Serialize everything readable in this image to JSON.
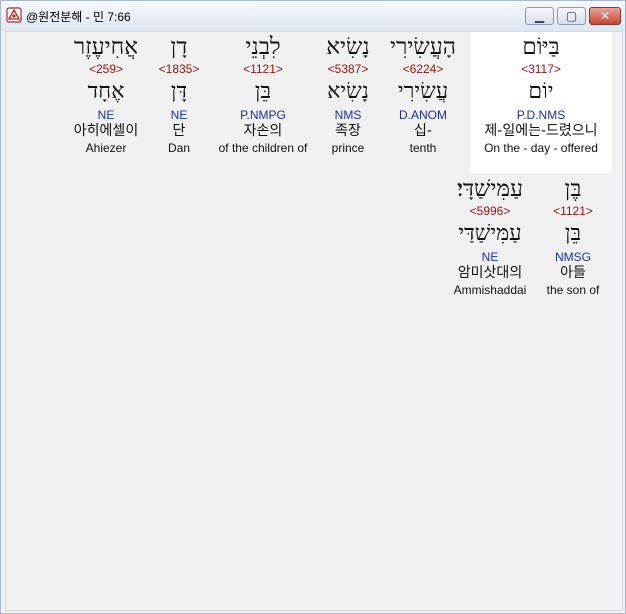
{
  "window": {
    "title": "@원전분해 - 민 7:66",
    "icons": {
      "app": "app-icon",
      "minimize": "minimize-icon",
      "maximize": "maximize-icon",
      "close": "close-icon"
    }
  },
  "colors": {
    "strong": "#9a1010",
    "morph": "#1a2fb0",
    "text": "#111111",
    "highlight": "#ffffff"
  },
  "words": [
    {
      "hebrew": "בַּיּוֹם",
      "strong": "<3117>",
      "lexeme": "יוֹם",
      "morph": "P.D.NMS",
      "korean": "제-일에는-드렸으니",
      "english": "On the - day - offered"
    },
    {
      "hebrew": "הָעֲשִׂירִי",
      "strong": "<6224>",
      "lexeme": "עֲשִׂירִי",
      "morph": "D.ANOM",
      "korean": "십-",
      "english": "tenth"
    },
    {
      "hebrew": "נָשִׂיא",
      "strong": "<5387>",
      "lexeme": "נָשִׂיא",
      "morph": "NMS",
      "korean": "족장",
      "english": "prince"
    },
    {
      "hebrew": "לִבְנֵי",
      "strong": "<1121>",
      "lexeme": "בֵּן",
      "morph": "P.NMPG",
      "korean": "자손의",
      "english": "of the children of"
    },
    {
      "hebrew": "דָן",
      "strong": "<1835>",
      "lexeme": "דָּן",
      "morph": "NE",
      "korean": "단",
      "english": "Dan"
    },
    {
      "hebrew": "אֲחִיעֶזֶר",
      "strong": "<259>",
      "lexeme": "אֶחָד",
      "morph": "NE",
      "korean": "아히에셀이",
      "english": "Ahiezer"
    },
    {
      "hebrew": "בֶּן",
      "strong": "<1121>",
      "lexeme": "בֵּן",
      "morph": "NMSG",
      "korean": "아들",
      "english": "the son of"
    },
    {
      "hebrew": "עַמִּישַׁדָּי׃",
      "strong": "<5996>",
      "lexeme": "עַמִּישַׁדַּי",
      "morph": "NE",
      "korean": "암미삿대의",
      "english": "Ammishaddai"
    }
  ]
}
